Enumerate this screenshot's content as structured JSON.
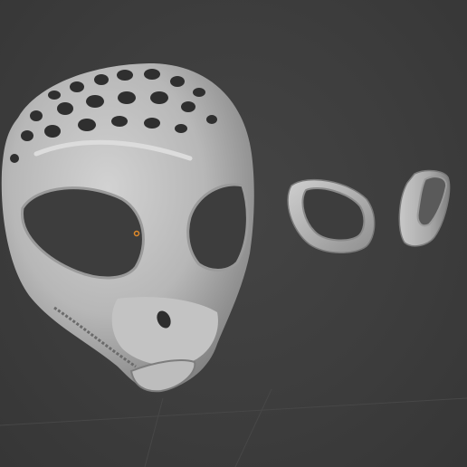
{
  "viewport": {
    "background": "#3d3d3d",
    "grid_color": "#4a4a4a",
    "mesh_color": "#b9b9b9",
    "mesh_shadow": "#8a8a8a",
    "origin_marker_color": "#e08a2a"
  },
  "scene": {
    "objects": [
      {
        "kind": "mask-head"
      },
      {
        "kind": "eye-ring"
      },
      {
        "kind": "eye-lens-cylinder"
      }
    ]
  }
}
